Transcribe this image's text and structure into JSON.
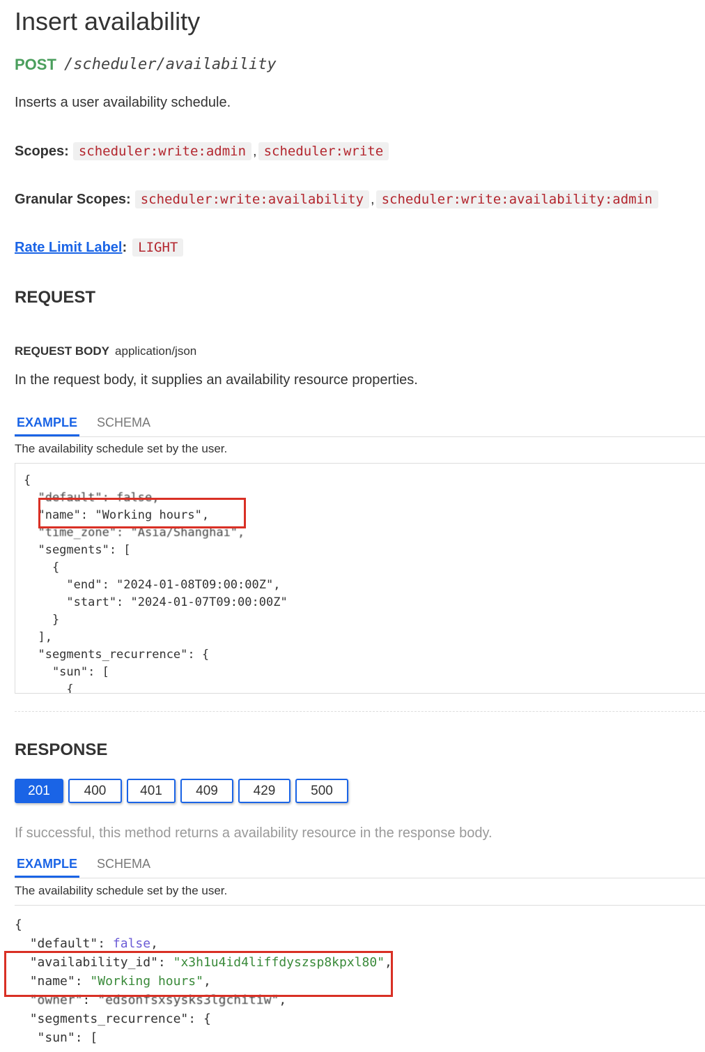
{
  "page": {
    "title": "Insert availability",
    "method": "POST",
    "path": "/scheduler/availability",
    "description": "Inserts a user availability schedule."
  },
  "scopes": {
    "label": "Scopes:",
    "items": [
      "scheduler:write:admin",
      "scheduler:write"
    ]
  },
  "granular_scopes": {
    "label": "Granular Scopes:",
    "items": [
      "scheduler:write:availability",
      "scheduler:write:availability:admin"
    ]
  },
  "rate_limit": {
    "label": "Rate Limit Label",
    "value": "LIGHT"
  },
  "request": {
    "heading": "REQUEST",
    "body_label": "REQUEST BODY",
    "content_type": "application/json",
    "body_description": "In the request body, it supplies an availability resource properties.",
    "tabs": [
      "EXAMPLE",
      "SCHEMA"
    ],
    "example_description": "The availability schedule set by the user.",
    "code_lines": [
      "{",
      "  \"default\": false,",
      "  \"name\": \"Working hours\",",
      "  \"time_zone\": \"Asia/Shanghai\",",
      "  \"segments\": [",
      "    {",
      "      \"end\": \"2024-01-08T09:00:00Z\",",
      "      \"start\": \"2024-01-07T09:00:00Z\"",
      "    }",
      "  ],",
      "  \"segments_recurrence\": {",
      "    \"sun\": [",
      "      {"
    ]
  },
  "response": {
    "heading": "RESPONSE",
    "status_codes": [
      "201",
      "400",
      "401",
      "409",
      "429",
      "500"
    ],
    "selected_code": "201",
    "description": "If successful, this method returns a availability resource in the response body.",
    "tabs": [
      "EXAMPLE",
      "SCHEMA"
    ],
    "example_description": "The availability schedule set by the user.",
    "code": {
      "open": "{",
      "default_key": "\"default\"",
      "default_val": "false",
      "availability_id_key": "\"availability_id\"",
      "availability_id_val": "\"x3h1u4id4liffdyszsp8kpxl80\"",
      "name_key": "\"name\"",
      "name_val": "\"Working hours\"",
      "owner_key": "\"owner\"",
      "owner_val": "\"edsonfsxsysks3lgchitiw\"",
      "segments_recurrence_key": "\"segments_recurrence\"",
      "sun_key": "\"sun\""
    }
  },
  "colors": {
    "method": "#4a9e5c",
    "accent": "#1a64e6",
    "chip_text": "#b3262e",
    "highlight": "#d93025"
  }
}
